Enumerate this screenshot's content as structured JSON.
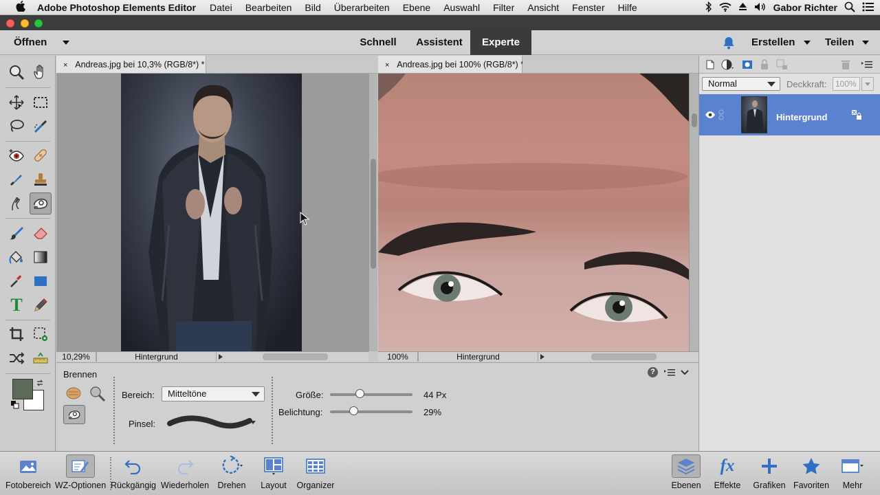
{
  "menubar": {
    "apple": "",
    "app_name": "Adobe Photoshop Elements Editor",
    "items": [
      "Datei",
      "Bearbeiten",
      "Bild",
      "Überarbeiten",
      "Ebene",
      "Auswahl",
      "Filter",
      "Ansicht",
      "Fenster",
      "Hilfe"
    ],
    "user": "Gabor Richter"
  },
  "topbar": {
    "open_label": "Öffnen",
    "modes": [
      "Schnell",
      "Assistent",
      "Experte"
    ],
    "active_mode": "Experte",
    "create_label": "Erstellen",
    "share_label": "Teilen"
  },
  "documents": [
    {
      "tab_title": "Andreas.jpg bei 10,3% (RGB/8*) *",
      "zoom": "10,29%",
      "layer": "Hintergrund"
    },
    {
      "tab_title": "Andreas.jpg bei 100% (RGB/8*) *",
      "zoom": "100%",
      "layer": "Hintergrund"
    }
  ],
  "options": {
    "tool_name": "Brennen",
    "range_label": "Bereich:",
    "range_value": "Mitteltöne",
    "brush_label": "Pinsel:",
    "size_label": "Größe:",
    "size_value": "44 Px",
    "size_fraction": 0.36,
    "exposure_label": "Belichtung:",
    "exposure_value": "29%",
    "exposure_fraction": 0.29
  },
  "layers_panel": {
    "blend_mode": "Normal",
    "opacity_label": "Deckkraft:",
    "opacity_value": "100%",
    "layer_name": "Hintergrund"
  },
  "bottombar": {
    "left": [
      "Fotobereich",
      "WZ-Optionen",
      "Rückgängig",
      "Wiederholen",
      "Drehen",
      "Layout",
      "Organizer"
    ],
    "right": [
      "Ebenen",
      "Effekte",
      "Grafiken",
      "Favoriten",
      "Mehr"
    ]
  },
  "colors": {
    "foreground": "#5e6a58",
    "background": "#ffffff",
    "selected_layer": "#5b82cf",
    "active_mode": "#3b3b3b",
    "accent_icon": "#2f6fc4"
  }
}
